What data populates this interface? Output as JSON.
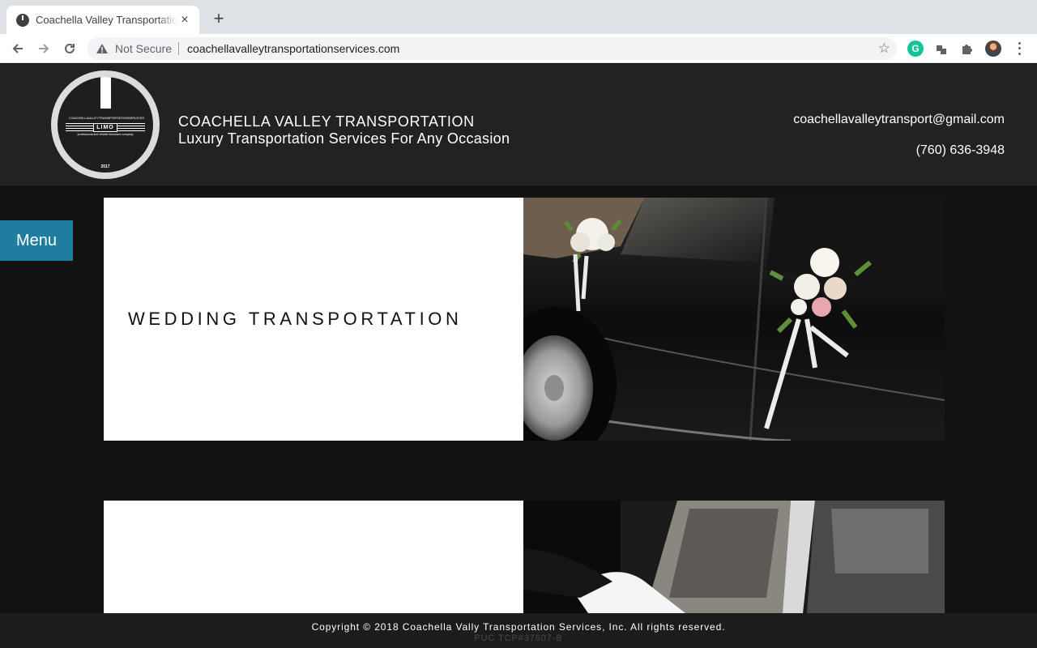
{
  "browser": {
    "tab_title": "Coachella Valley Transportation",
    "tab_close": "×",
    "new_tab": "+",
    "security_label": "Not Secure",
    "url": "coachellavalleytranspo rtationservices.com",
    "star": "☆",
    "grammarly_letter": "G"
  },
  "header": {
    "title": "COACHELLA VALLEY TRANSPORTATION",
    "subtitle": "Luxury Transportation Services For Any Occasion",
    "email": "coachellavalleytransport@gmail.com",
    "phone": "(760) 636-3948",
    "logo": {
      "words": [
        "COACHELLA",
        "ALLEY",
        "TRANSPORTATION",
        "SERVICES"
      ],
      "limo": "LIMO",
      "tagline": "professional and reliable limousine company",
      "year": "2017"
    }
  },
  "menu": {
    "label": "Menu"
  },
  "sections": [
    {
      "heading": "WEDDING TRANSPORTATION",
      "photo": "wedding-car-photo"
    },
    {
      "heading": "",
      "photo": "chauffeur-car-door-photo"
    }
  ],
  "footer": {
    "copyright": "Copyright © 2018 Coachella Vally Transportation Services, Inc. All rights reserved.",
    "license": "PUC TCP#37607-B"
  },
  "colors": {
    "header_bg": "#222222",
    "page_bg": "#121212",
    "menu_bg": "#1f7da0"
  }
}
